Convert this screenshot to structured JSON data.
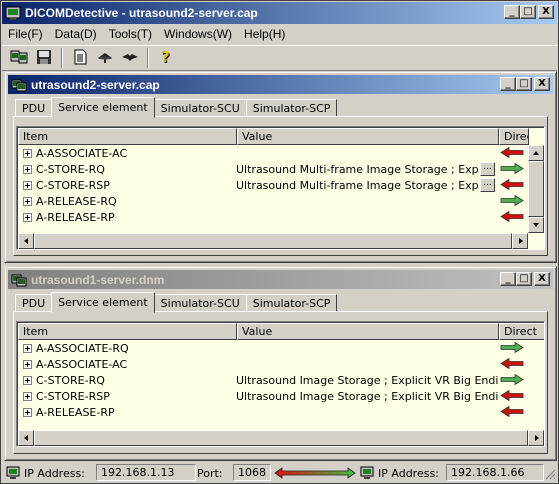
{
  "app": {
    "title": "DICOMDetective - utrasound2-server.cap",
    "window_buttons": {
      "minimize": "_",
      "maximize": "□",
      "close": "X"
    }
  },
  "menu": [
    "File(F)",
    "Data(D)",
    "Tools(T)",
    "Windows(W)",
    "Help(H)"
  ],
  "toolbar": {
    "icons": [
      "open-capture-icon",
      "save-icon",
      "document-icon",
      "network-hat-icon",
      "network-bird-icon",
      "help-question-icon"
    ]
  },
  "windows": [
    {
      "title": "utrasound2-server.cap",
      "active": true,
      "tabs": [
        "PDU",
        "Service element",
        "Simulator-SCU",
        "Simulator-SCP"
      ],
      "selected_tab": 1,
      "columns": [
        "Item",
        "Value",
        "Direct"
      ],
      "rows": [
        {
          "item": "A-ASSOCIATE-AC",
          "value": "",
          "more": false,
          "direction": "left"
        },
        {
          "item": "C-STORE-RQ",
          "value": "Ultrasound Multi-frame Image Storage ; Explicit VR",
          "more": true,
          "direction": "right"
        },
        {
          "item": "C-STORE-RSP",
          "value": "Ultrasound Multi-frame Image Storage ; Explicit VR",
          "more": true,
          "direction": "left"
        },
        {
          "item": "A-RELEASE-RQ",
          "value": "",
          "more": false,
          "direction": "right"
        },
        {
          "item": "A-RELEASE-RP",
          "value": "",
          "more": false,
          "direction": "left"
        }
      ],
      "more_label": "..."
    },
    {
      "title": "utrasound1-server.dnm",
      "active": false,
      "tabs": [
        "PDU",
        "Service element",
        "Simulator-SCU",
        "Simulator-SCP"
      ],
      "selected_tab": 1,
      "columns": [
        "Item",
        "Value",
        "Direct"
      ],
      "rows": [
        {
          "item": "A-ASSOCIATE-RQ",
          "value": "",
          "direction": "right"
        },
        {
          "item": "A-ASSOCIATE-AC",
          "value": "",
          "direction": "left"
        },
        {
          "item": "C-STORE-RQ",
          "value": "Ultrasound Image Storage ; Explicit VR Big Endian",
          "direction": "right"
        },
        {
          "item": "C-STORE-RSP",
          "value": "Ultrasound Image Storage ; Explicit VR Big Endian",
          "direction": "left"
        },
        {
          "item": "A-RELEASE-RP",
          "value": "",
          "direction": "left"
        }
      ]
    }
  ],
  "status": {
    "ip_label_1": "IP Address:",
    "ip_1": "192.168.1.13",
    "port_label": "Port:",
    "port": "1068",
    "ip_label_2": "IP Address:",
    "ip_2": "192.168.1.66"
  },
  "colors": {
    "title_active": "#0a246a",
    "title_inactive": "#808080",
    "list_bg": "#ffffe6",
    "arrow_right": "#4caf50",
    "arrow_left": "#d01010"
  }
}
